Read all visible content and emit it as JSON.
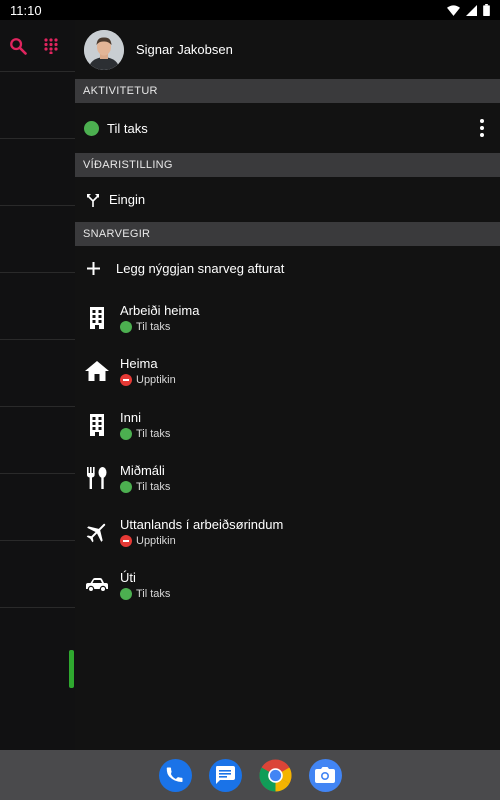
{
  "status_bar": {
    "time": "11:10",
    "icons": [
      "wifi-icon",
      "signal-icon",
      "battery-icon"
    ]
  },
  "left_panel": {
    "icons": [
      "search-icon",
      "dialpad-icon"
    ],
    "accent_color": "#e0245e"
  },
  "user": {
    "name": "Signar Jakobsen"
  },
  "activity": {
    "header": "AKTIVITETUR",
    "status_label": "Til taks",
    "status_color": "#4caf50"
  },
  "forwarding": {
    "header": "VÍÐARISTILLING",
    "value": "Eingin"
  },
  "shortcuts": {
    "header": "SNARVEGIR",
    "add_label": "Legg nýggjan snarveg afturat",
    "items": [
      {
        "name": "Arbeiði heima",
        "status": "Til taks",
        "icon": "building-icon",
        "state": "available"
      },
      {
        "name": "Heima",
        "status": "Upptikin",
        "icon": "home-icon",
        "state": "busy"
      },
      {
        "name": "Inni",
        "status": "Til taks",
        "icon": "building-icon",
        "state": "available"
      },
      {
        "name": "Miðmáli",
        "status": "Til taks",
        "icon": "restaurant-icon",
        "state": "available"
      },
      {
        "name": "Uttanlands í arbeiðsørindum",
        "status": "Upptikin",
        "icon": "airplane-icon",
        "state": "busy"
      },
      {
        "name": "Úti",
        "status": "Til taks",
        "icon": "car-icon",
        "state": "available"
      }
    ]
  },
  "dock": {
    "apps": [
      "phone-app-icon",
      "messages-app-icon",
      "chrome-app-icon",
      "camera-app-icon"
    ]
  }
}
